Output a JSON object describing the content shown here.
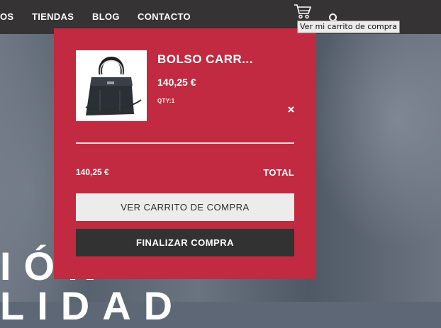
{
  "nav": {
    "items": [
      "OS",
      "TIENDAS",
      "BLOG",
      "CONTACTO"
    ],
    "cart_icon": "cart-icon",
    "search_icon": "search-icon",
    "tooltip": "Ver mi carrito de compra"
  },
  "hero": {
    "text": "IÓN\nLIDAD"
  },
  "cart": {
    "item": {
      "title": "BOLSO CARR...",
      "price": "140,25 €",
      "qty": "QTY:1",
      "image_icon": "handbag-image",
      "remove_icon": "close-icon"
    },
    "subtotal": "140,25 €",
    "total_label": "TOTAL",
    "view_cart_label": "VER CARRITO DE COMPRA",
    "checkout_label": "FINALIZAR COMPRA"
  },
  "colors": {
    "navbar": "#353334",
    "panel": "#c12a40",
    "view_button": "#ececec",
    "checkout_button": "#333233"
  }
}
